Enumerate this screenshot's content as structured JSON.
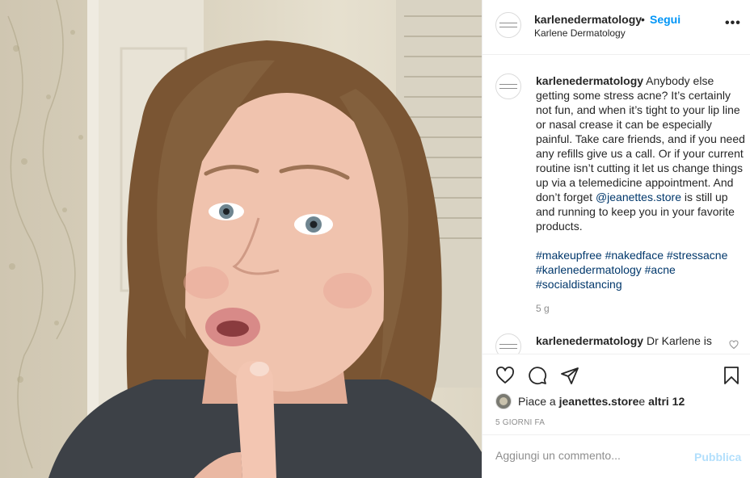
{
  "post": {
    "username": "karlenedermatology",
    "dot": "•",
    "follow_label": "Segui",
    "subtitle": "Karlene Dermatology",
    "more_icon": "more-options-icon"
  },
  "caption": {
    "username": "karlenedermatology",
    "text_before": " Anybody else getting some stress acne? It’s certainly not fun, and when it’s tight to your lip line or nasal crease it can be especially painful. Take care friends, and if you need any refills give us a call. Or if your current routine isn’t cutting it let us change things up via a telemedicine appointment. And don’t forget ",
    "mention": "@jeanettes.store",
    "text_after": " is still up and running to keep you in your favorite products.",
    "hashtags": "#makeupfree #nakedface #stressacne #karlenedermatology #acne #socialdistancing",
    "time": "5 g"
  },
  "comment2": {
    "username": "karlenedermatology",
    "text": " Dr Karlene is"
  },
  "likes": {
    "prefix": "Piace a ",
    "user": "jeanettes.store",
    "middle": " e ",
    "others": "altri 12"
  },
  "date": "5 GIORNI FA",
  "composer": {
    "placeholder": "Aggiungi un commento...",
    "publish_label": "Pubblica"
  },
  "colors": {
    "link": "#00376b",
    "follow": "#0095f6",
    "publish_disabled": "#b2dffc",
    "muted": "#8e8e8e"
  }
}
